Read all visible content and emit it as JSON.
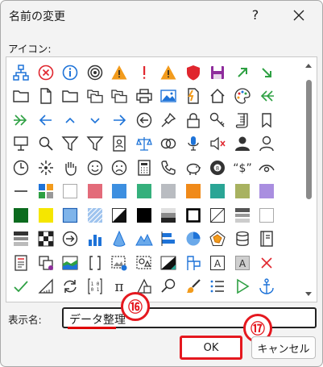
{
  "window": {
    "title": "名前の変更",
    "help": "?",
    "close_icon": "close-icon"
  },
  "icons_section": {
    "label": "アイコン:"
  },
  "icon_rows": [
    [
      "hierarchy-icon",
      "cancel-icon",
      "info-icon",
      "target-icon",
      "warning-icon",
      "exclamation-icon",
      "warning-icon",
      "shield-icon",
      "save-icon",
      "arrow-up-right-icon",
      "arrow-down-right-icon"
    ],
    [
      "folder-icon",
      "document-icon",
      "folder-icon",
      "folders-icon",
      "folders-icon",
      "printer-icon",
      "picture-icon",
      "flash-document-icon",
      "home-icon",
      "palette-icon",
      "double-arrow-left-icon"
    ],
    [
      "double-arrow-right-icon",
      "arrow-left-icon",
      "chevron-up-icon",
      "chevron-down-icon",
      "arrow-right-icon",
      "circle-arrow-left-icon",
      "pin-icon",
      "lock-icon",
      "key-icon",
      "scroll-icon",
      "bookmark-icon"
    ],
    [
      "presentation-icon",
      "search-icon",
      "filter-icon",
      "filter-icon",
      "contact-card-icon",
      "scale-icon",
      "venn-icon",
      "microphone-icon",
      "mute-icon",
      "user-icon",
      "person-icon"
    ],
    [
      "clock-icon",
      "sparkle-icon",
      "hand-icon",
      "smiley-icon",
      "sad-face-icon",
      "calculator-icon",
      "phone-icon",
      "piggy-bank-icon",
      "eight-ball-icon",
      "quote-dollar-icon",
      "eye-icon"
    ],
    [
      "minus-icon",
      "color-blocks-icon",
      "blank-square-icon",
      "pink-square-icon",
      "blue-square-icon",
      "green-square-icon",
      "gray-square-icon",
      "orange-square-icon",
      "teal-square-icon",
      "olive-square-icon",
      "purple-square-icon"
    ],
    [
      "dark-green-square-icon",
      "yellow-square-icon",
      "blue-outline-square-icon",
      "hatched-square-icon",
      "diagonal-split-icon",
      "black-square-icon",
      "gradient-square-icon",
      "bold-outline-square-icon",
      "diagonal-line-square-icon",
      "horizontal-bars-icon",
      "empty-square-icon"
    ],
    [
      "gradient-bars-icon",
      "checker-icon",
      "circle-arrow-right-icon",
      "bar-chart-icon",
      "cone-icon",
      "mountains-icon",
      "bar-layout-icon",
      "pie-chart-icon",
      "radar-icon",
      "database-icon",
      "notebook-icon"
    ],
    [
      "list-card-icon",
      "linked-squares-icon",
      "area-chart-icon",
      "bracket-icon",
      "picture-frame-icon",
      "shapes-icon",
      "triangle-fill-icon",
      "flags-icon",
      "text-box-icon",
      "text-box-shaded-icon",
      "close-x-icon"
    ],
    [
      "checkmark-icon",
      "ruler-icon",
      "refresh-icon",
      "binary-icon",
      "pi-icon",
      "shape-icon",
      "magnifier-icon",
      "brush-icon",
      "list-icon",
      "play-icon",
      "anchor-icon"
    ]
  ],
  "display_name": {
    "label": "表示名:",
    "value": "データ整理"
  },
  "buttons": {
    "ok": "OK",
    "cancel": "キャンセル"
  },
  "annotations": {
    "step16": "⑯",
    "step17": "⑰"
  },
  "colors": {
    "annotation_red": "#e5181f",
    "accent_blue": "#1e73d8",
    "warning_orange": "#f29b1c"
  }
}
